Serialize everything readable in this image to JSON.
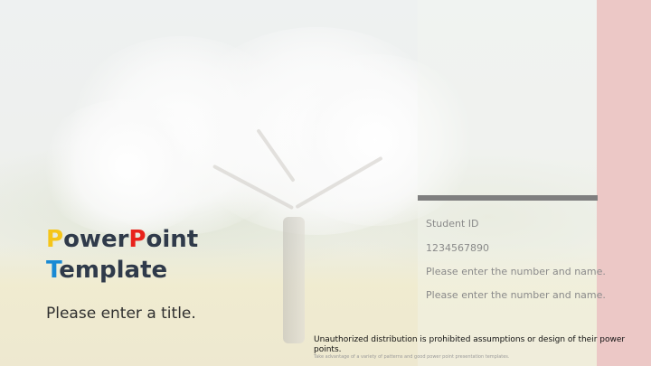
{
  "slide": {
    "title_line1": [
      {
        "text": "P",
        "color": "#f5c518"
      },
      {
        "text": "ower",
        "color": "#2f3a4a"
      },
      {
        "text": "P",
        "color": "#e8221b"
      },
      {
        "text": "oint",
        "color": "#2f3a4a"
      }
    ],
    "title_line2": [
      {
        "text": "T",
        "color": "#1a8ad4"
      },
      {
        "text": "emplate",
        "color": "#2f3a4a"
      }
    ],
    "subtitle": "Please enter a title.",
    "info": {
      "student_id_label": "Student ID",
      "student_id_value": "1234567890",
      "name_line1": "Please enter the number and name.",
      "name_line2": "Please enter the number and name."
    },
    "disclaimer": "Unauthorized distribution is prohibited assumptions or design of their power points.",
    "fine_print": "Take advantage of a variety of patterns and good power point presentation templates."
  },
  "colors": {
    "accent_strip": "#ecc8c6",
    "divider_bar": "#7f7f7f",
    "title_text": "#2f3a4a"
  }
}
